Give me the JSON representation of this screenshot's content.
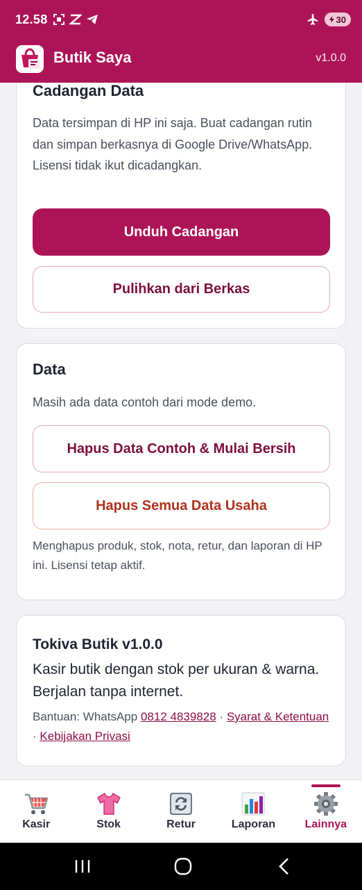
{
  "status_bar": {
    "time": "12.58",
    "battery": "30"
  },
  "app_bar": {
    "title": "Butik Saya",
    "version": "v1.0.0"
  },
  "backup_card": {
    "title": "Cadangan Data",
    "description": "Data tersimpan di HP ini saja. Buat cadangan rutin dan simpan berkasnya di Google Drive/WhatsApp. Lisensi tidak ikut dicadangkan.",
    "download_button": "Unduh Cadangan",
    "restore_button": "Pulihkan dari Berkas"
  },
  "data_card": {
    "title": "Data",
    "description": "Masih ada data contoh dari mode demo.",
    "clear_demo_button": "Hapus Data Contoh & Mulai Bersih",
    "delete_all_button": "Hapus Semua Data Usaha",
    "note": "Menghapus produk, stok, nota, retur, dan laporan di HP ini. Lisensi tetap aktif."
  },
  "about_card": {
    "title": "Tokiva Butik v1.0.0",
    "tagline": "Kasir butik dengan stok per ukuran & warna. Berjalan tanpa internet.",
    "help_prefix": "Bantuan: WhatsApp",
    "phone": "0812 4839828",
    "separator": "·",
    "terms": "Syarat & Ketentuan",
    "privacy": "Kebijakan Privasi"
  },
  "bottom_nav": {
    "items": [
      {
        "label": "Kasir",
        "icon": "shopping-cart-icon"
      },
      {
        "label": "Stok",
        "icon": "shirt-icon"
      },
      {
        "label": "Retur",
        "icon": "return-arrows-icon"
      },
      {
        "label": "Laporan",
        "icon": "bar-chart-icon"
      },
      {
        "label": "Lainnya",
        "icon": "gear-icon"
      }
    ],
    "active": "Lainnya"
  },
  "colors": {
    "brand": "#ad1457",
    "danger": "#b0321d"
  }
}
